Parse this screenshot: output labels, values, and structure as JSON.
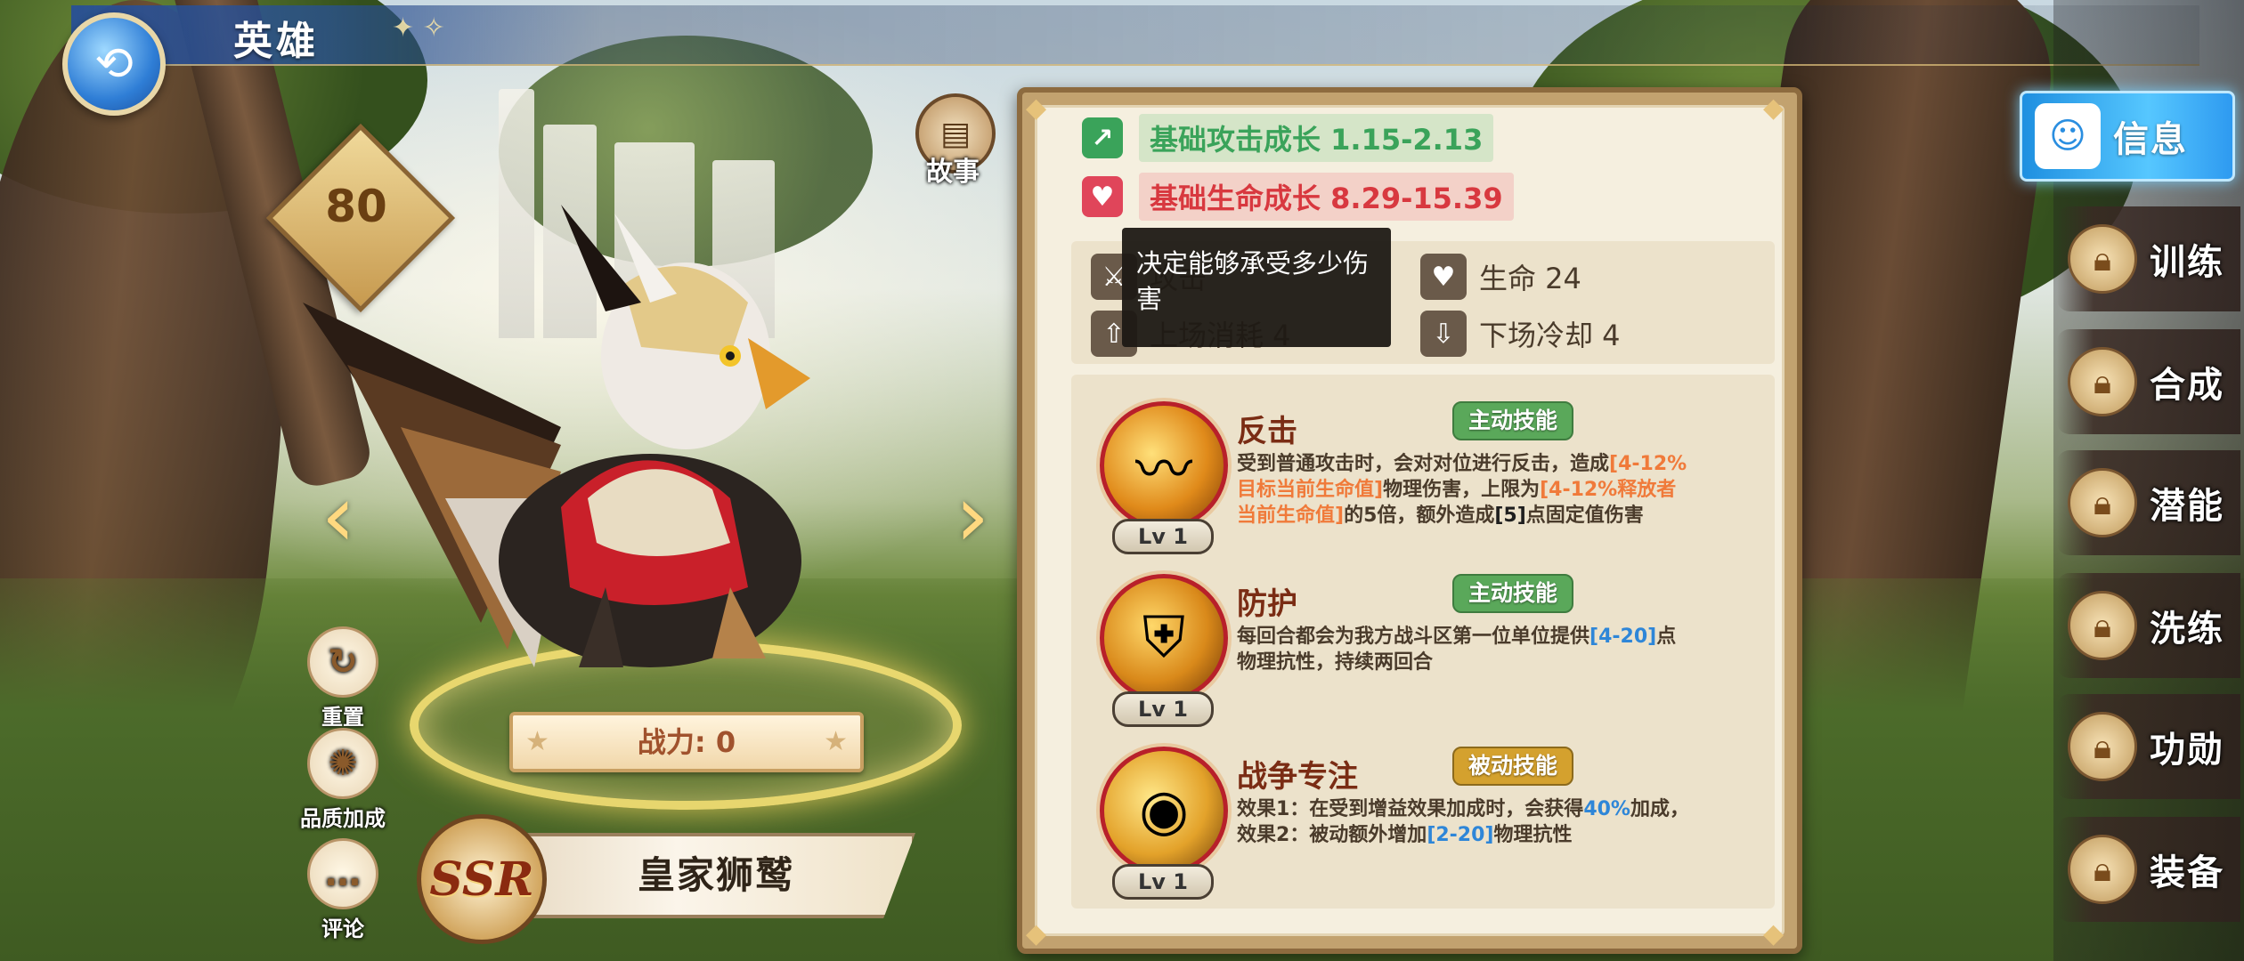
{
  "header": {
    "title": "英雄",
    "back_icon": "back-arrow-icon"
  },
  "hero": {
    "level": "80",
    "story_label": "故事",
    "power_label": "战力: 0",
    "rarity": "SSR",
    "name": "皇家狮鹫"
  },
  "left_actions": [
    {
      "label": "重置",
      "icon": "reset-icon"
    },
    {
      "label": "品质加成",
      "icon": "quality-icon"
    },
    {
      "label": "评论",
      "icon": "comment-icon"
    }
  ],
  "stats": {
    "attack_growth": "基础攻击成长  1.15-2.13",
    "hp_growth": "基础生命成长  8.29-15.39",
    "hp": "生命  24",
    "deploy": "上场消耗  4",
    "cooldown": "下场冷却  4",
    "hidden_attack": "攻击"
  },
  "tooltip": {
    "text": "决定能够承受多少伤害"
  },
  "skills": [
    {
      "name": "反击",
      "tag": "主动技能",
      "level": "Lv 1",
      "desc_parts": [
        "受到普通攻击时，会对对位进行反击，造成",
        "[4-12%目标当前生命值]",
        "物理伤害，上限为",
        "[4-12%释放者当前生命值]",
        "的5倍，额外造成",
        "[5]",
        "点固定值伤害"
      ]
    },
    {
      "name": "防护",
      "tag": "主动技能",
      "level": "Lv 1",
      "desc_parts": [
        "每回合都会为我方战斗区第一位单位提供",
        "[4-20]",
        "点物理抗性，持续两回合"
      ]
    },
    {
      "name": "战争专注",
      "tag": "被动技能",
      "level": "Lv 1",
      "desc_parts": [
        "效果1：在受到增益效果加成时，会获得",
        "40%",
        "加成，效果2：被动额外增加",
        "[2-20]",
        "物理抗性"
      ]
    }
  ],
  "menu": {
    "active": "信息",
    "items": [
      "训练",
      "合成",
      "潜能",
      "洗练",
      "功勋",
      "装备"
    ]
  },
  "colors": {
    "accent_blue": "#2e86d8",
    "highlight_orange": "#f07a3a",
    "active_tag_green": "#5aa85a",
    "passive_tag_gold": "#d4a12e"
  }
}
